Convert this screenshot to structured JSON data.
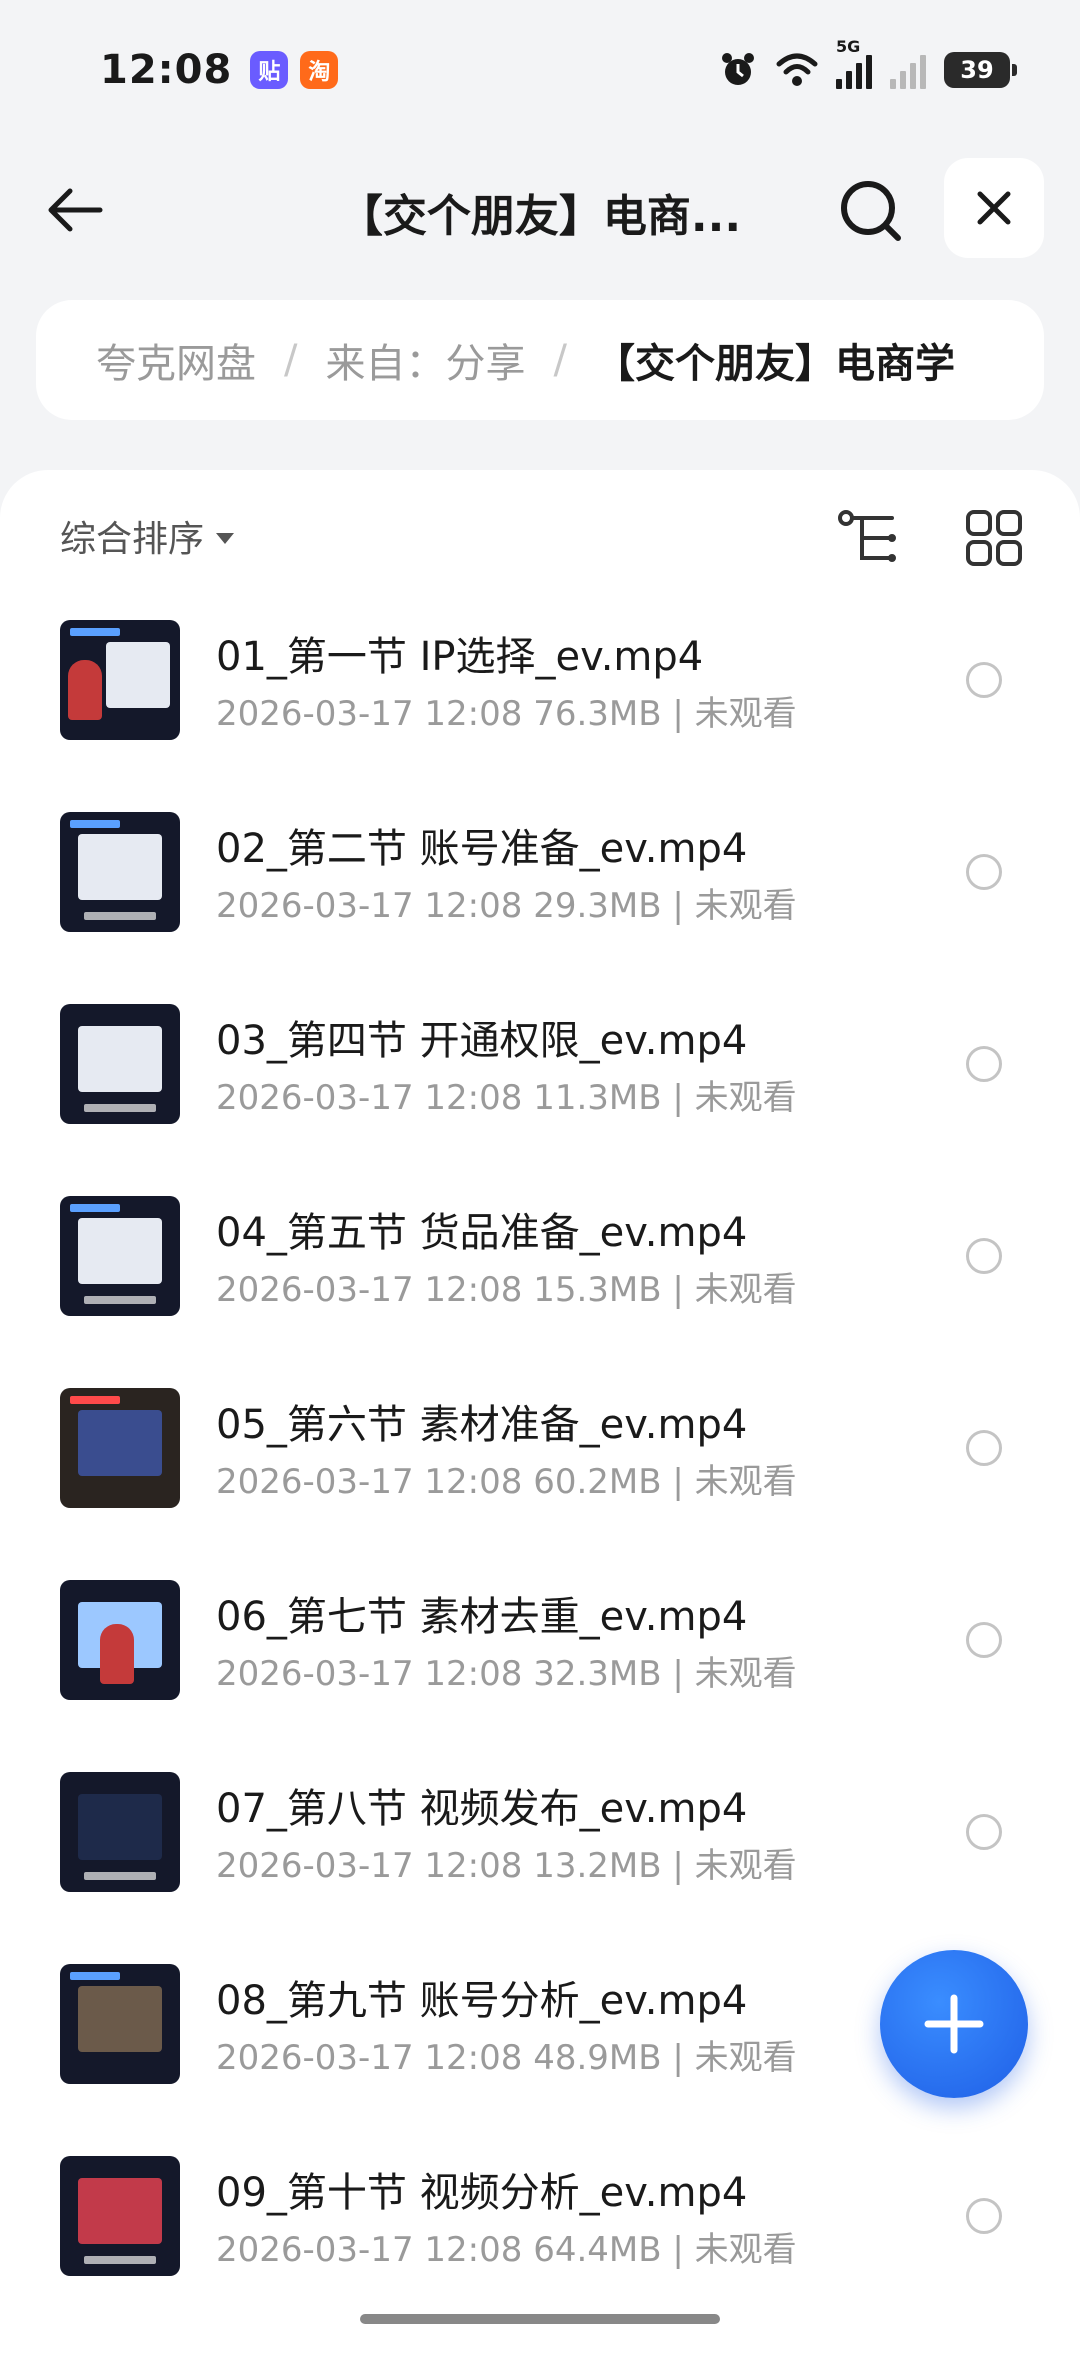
{
  "status_bar": {
    "time": "12:08",
    "app_badges": [
      {
        "text": "贴",
        "color": "#6a5cff"
      },
      {
        "text": "淘",
        "color": "#ff6a1a"
      }
    ],
    "network": "5G",
    "battery": "39"
  },
  "header": {
    "title": "【交个朋友】电商...",
    "icons": [
      "back-arrow-icon",
      "search-icon",
      "close-icon"
    ]
  },
  "breadcrumb": {
    "items": [
      "夸克网盘",
      "来自：分享",
      "【交个朋友】电商学"
    ]
  },
  "toolbar": {
    "sort_label": "综合排序"
  },
  "files": [
    {
      "name": "01_第一节 IP选择_ev.mp4",
      "meta": "2026-03-17 12:08  76.3MB | 未观看"
    },
    {
      "name": "02_第二节 账号准备_ev.mp4",
      "meta": "2026-03-17 12:08  29.3MB | 未观看"
    },
    {
      "name": "03_第四节 开通权限_ev.mp4",
      "meta": "2026-03-17 12:08  11.3MB | 未观看"
    },
    {
      "name": "04_第五节 货品准备_ev.mp4",
      "meta": "2026-03-17 12:08  15.3MB | 未观看"
    },
    {
      "name": "05_第六节 素材准备_ev.mp4",
      "meta": "2026-03-17 12:08  60.2MB | 未观看"
    },
    {
      "name": "06_第七节 素材去重_ev.mp4",
      "meta": "2026-03-17 12:08  32.3MB | 未观看"
    },
    {
      "name": "07_第八节 视频发布_ev.mp4",
      "meta": "2026-03-17 12:08  13.2MB | 未观看"
    },
    {
      "name": "08_第九节 账号分析_ev.mp4",
      "meta": "2026-03-17 12:08  48.9MB | 未观看"
    },
    {
      "name": "09_第十节 视频分析_ev.mp4",
      "meta": "2026-03-17 12:08  64.4MB | 未观看"
    }
  ],
  "fab": {
    "icon": "plus-icon",
    "color": "#1f5fe6"
  }
}
